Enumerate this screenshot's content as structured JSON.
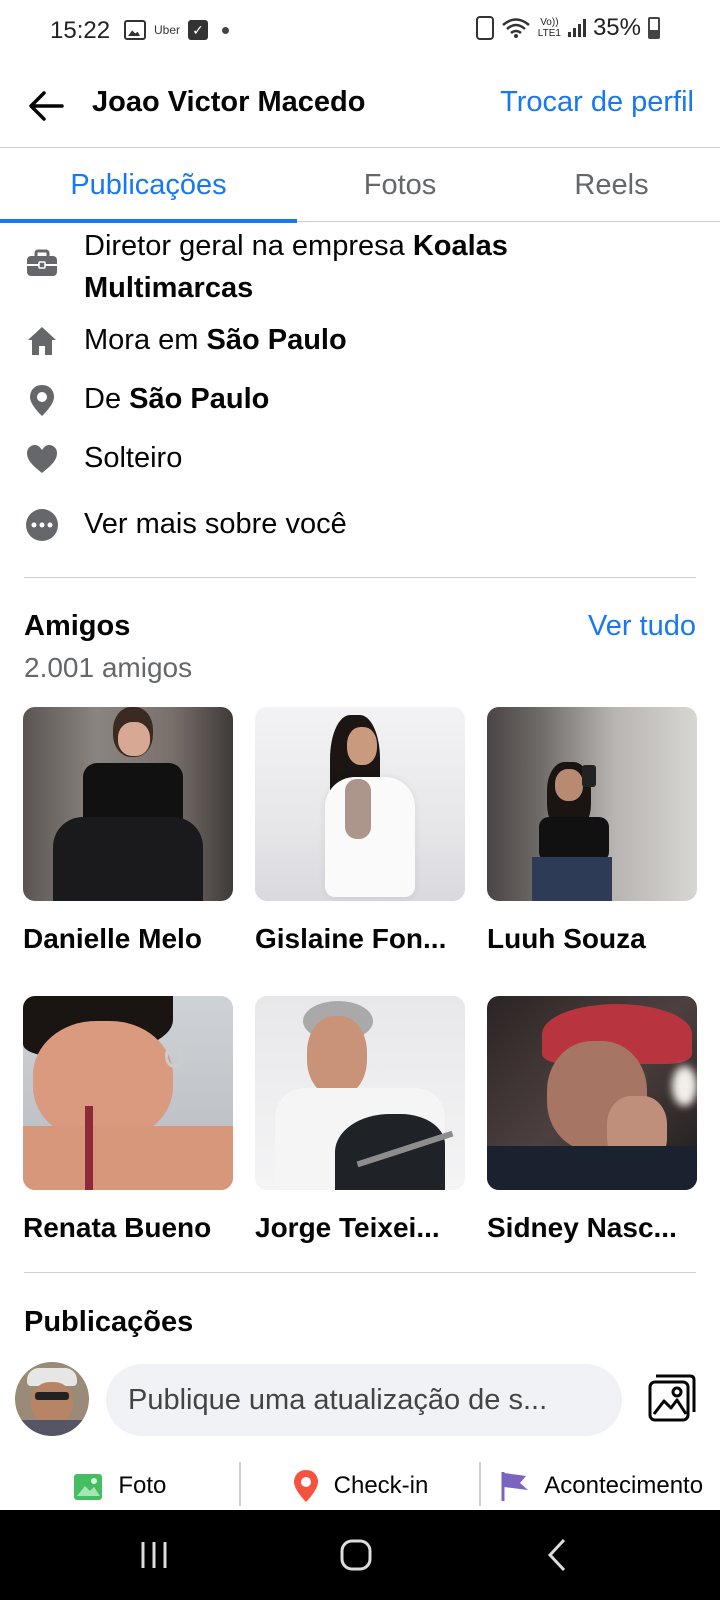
{
  "status_bar": {
    "time": "15:22",
    "uber_label": "Uber",
    "volte_top": "Vo))",
    "volte_bottom": "LTE1",
    "battery": "35%"
  },
  "header": {
    "title": "Joao Victor Macedo",
    "switch_profile": "Trocar de perfil"
  },
  "tabs": [
    {
      "label": "Publicações",
      "active": true
    },
    {
      "label": "Fotos",
      "active": false
    },
    {
      "label": "Reels",
      "active": false
    }
  ],
  "intro": {
    "work_prefix": "Diretor geral na empresa",
    "work_bold": "Koalas Multimarcas",
    "lives_prefix": "Mora em",
    "lives_bold": "São Paulo",
    "from_prefix": "De",
    "from_bold": "São Paulo",
    "relationship": "Solteiro",
    "see_more": "Ver mais sobre você"
  },
  "friends": {
    "title": "Amigos",
    "see_all": "Ver tudo",
    "count": "2.001 amigos",
    "list": [
      {
        "name": "Danielle Melo"
      },
      {
        "name": "Gislaine Fon..."
      },
      {
        "name": "Luuh Souza"
      },
      {
        "name": "Renata Bueno"
      },
      {
        "name": "Jorge Teixei..."
      },
      {
        "name": "Sidney Nasc..."
      }
    ]
  },
  "posts": {
    "title": "Publicações",
    "composer_placeholder": "Publique uma atualização de s...",
    "actions": [
      {
        "label": "Foto"
      },
      {
        "label": "Check-in"
      },
      {
        "label": "Acontecimento"
      }
    ]
  },
  "colors": {
    "accent": "#1877f2",
    "secondary_text": "#65676b",
    "divider": "#ccd0d5"
  }
}
